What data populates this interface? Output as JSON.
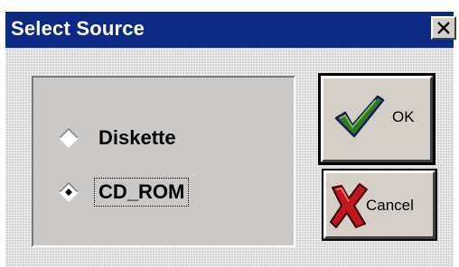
{
  "window": {
    "title": "Select Source"
  },
  "source_group": {
    "options": [
      {
        "label": "Diskette",
        "selected": false
      },
      {
        "label": "CD_ROM",
        "selected": true
      }
    ]
  },
  "buttons": {
    "ok_label": "OK",
    "cancel_label": "Cancel"
  },
  "icons": {
    "close": "close-icon",
    "ok": "checkmark-icon",
    "cancel": "red-x-icon"
  },
  "colors": {
    "titlebar": "#0c2a83",
    "checkmark": "#2f7a1f",
    "cancel_x": "#c0181b"
  }
}
